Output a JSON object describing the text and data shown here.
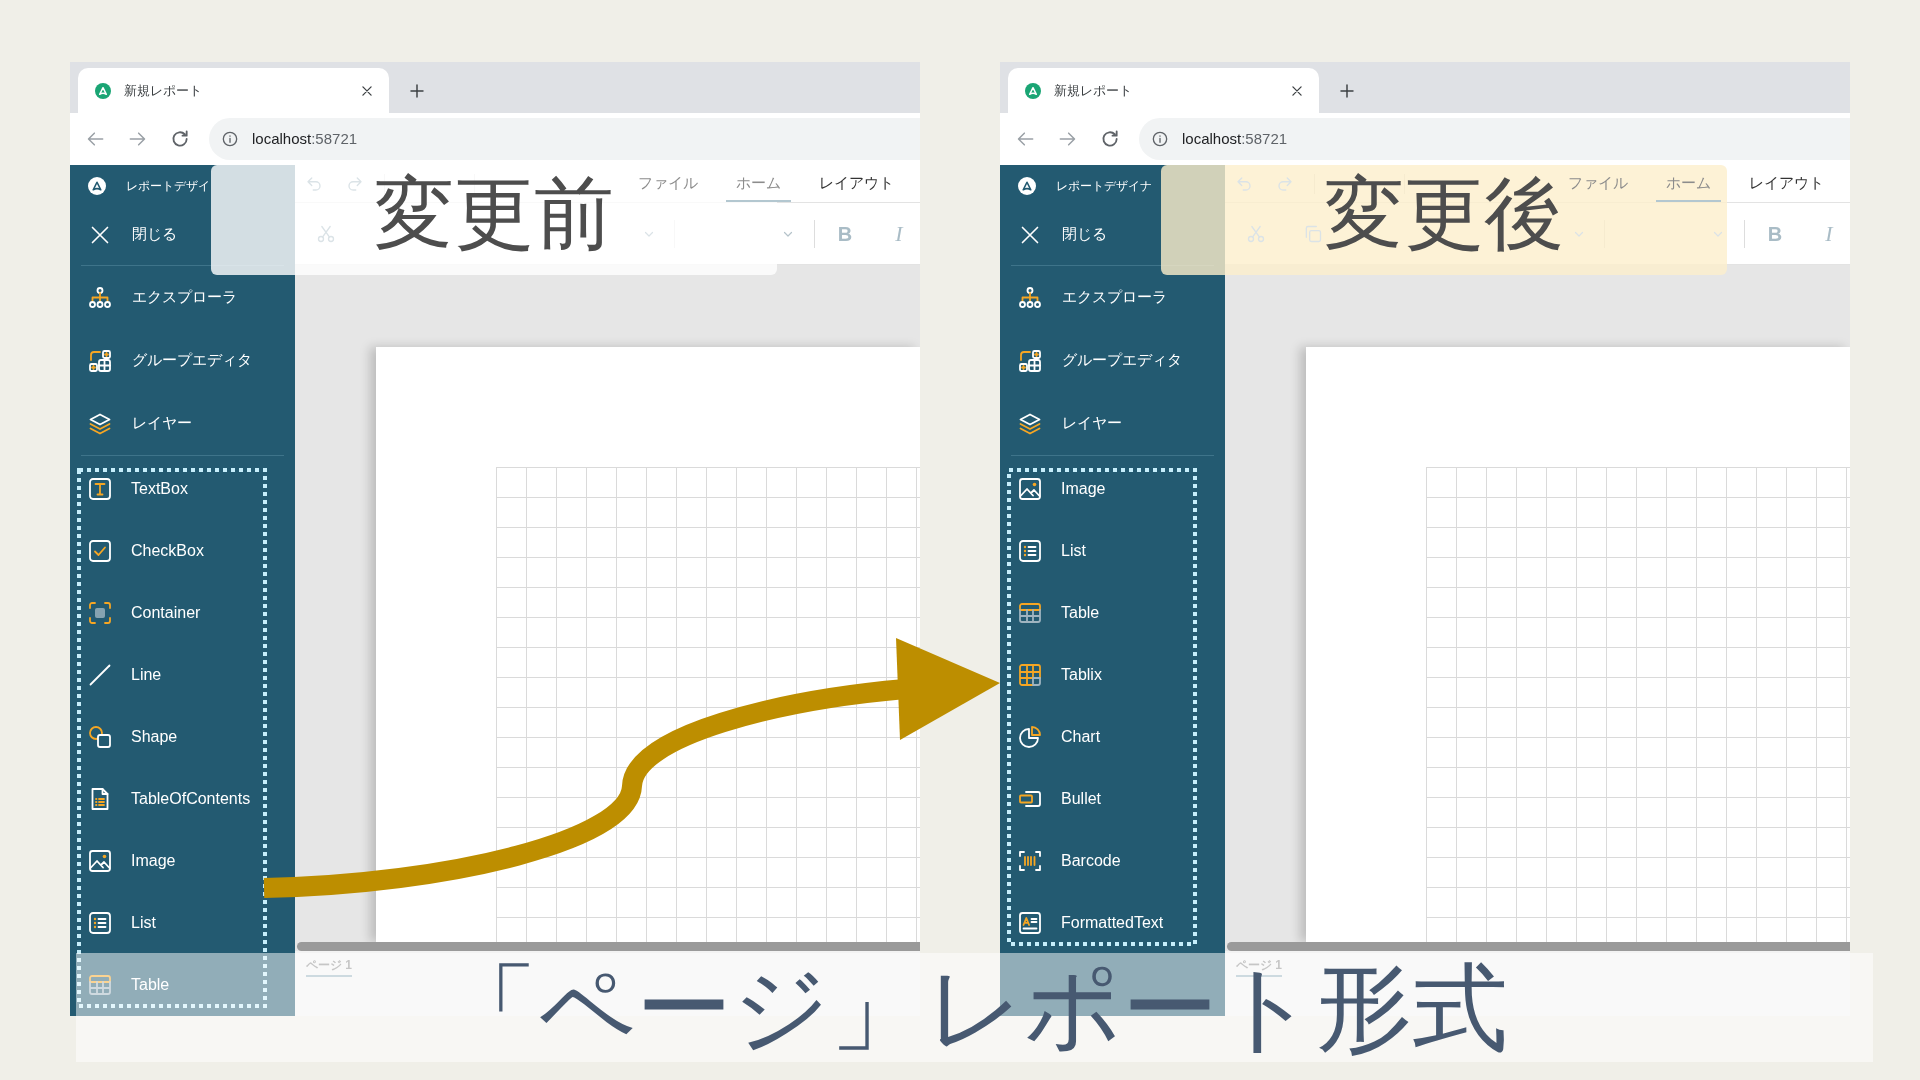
{
  "panels": [
    {
      "banner": {
        "text": "変更前",
        "kind": "before"
      },
      "browser": {
        "tab_title": "新規レポート",
        "url": {
          "host": "localhost",
          "port": ":58721"
        }
      },
      "app": {
        "title": "レポートデザイ",
        "close_label": "閉じる",
        "toolbar": {
          "tabs": [
            {
              "label": "ファイル",
              "selected": false
            },
            {
              "label": "ホーム",
              "selected": true
            },
            {
              "label": "レイアウト",
              "selected": false
            }
          ],
          "format_buttons": [
            {
              "label": "B",
              "kind": "bold"
            },
            {
              "label": "I",
              "kind": "italic"
            }
          ]
        },
        "panel_items": [
          {
            "label": "エクスプローラ",
            "kind": "explorer"
          },
          {
            "label": "グループエディタ",
            "kind": "group-editor"
          },
          {
            "label": "レイヤー",
            "kind": "layers"
          }
        ],
        "toolbox_items": [
          {
            "label": "TextBox",
            "kind": "textbox"
          },
          {
            "label": "CheckBox",
            "kind": "checkbox"
          },
          {
            "label": "Container",
            "kind": "container"
          },
          {
            "label": "Line",
            "kind": "line"
          },
          {
            "label": "Shape",
            "kind": "shape"
          },
          {
            "label": "TableOfContents",
            "kind": "toc"
          },
          {
            "label": "Image",
            "kind": "image"
          },
          {
            "label": "List",
            "kind": "list"
          },
          {
            "label": "Table",
            "kind": "table"
          }
        ],
        "page_tabs": [
          {
            "label": "ページ 1",
            "selected": true
          }
        ]
      }
    },
    {
      "banner": {
        "text": "変更後",
        "kind": "after"
      },
      "browser": {
        "tab_title": "新規レポート",
        "url": {
          "host": "localhost",
          "port": ":58721"
        }
      },
      "app": {
        "title": "レポートデザイナ",
        "close_label": "閉じる",
        "toolbar": {
          "tabs": [
            {
              "label": "ファイル",
              "selected": false
            },
            {
              "label": "ホーム",
              "selected": true
            },
            {
              "label": "レイアウト",
              "selected": false
            }
          ],
          "format_buttons": [
            {
              "label": "B",
              "kind": "bold"
            },
            {
              "label": "I",
              "kind": "italic"
            }
          ]
        },
        "panel_items": [
          {
            "label": "エクスプローラ",
            "kind": "explorer"
          },
          {
            "label": "グループエディタ",
            "kind": "group-editor"
          },
          {
            "label": "レイヤー",
            "kind": "layers"
          }
        ],
        "toolbox_items": [
          {
            "label": "Image",
            "kind": "image"
          },
          {
            "label": "List",
            "kind": "list"
          },
          {
            "label": "Table",
            "kind": "table"
          },
          {
            "label": "Tablix",
            "kind": "tablix"
          },
          {
            "label": "Chart",
            "kind": "chart"
          },
          {
            "label": "Bullet",
            "kind": "bullet"
          },
          {
            "label": "Barcode",
            "kind": "barcode"
          },
          {
            "label": "FormattedText",
            "kind": "formatted-text"
          }
        ],
        "page_tabs": [
          {
            "label": "ページ 1",
            "selected": true
          }
        ]
      }
    }
  ],
  "caption": "「ページ」レポート形式"
}
